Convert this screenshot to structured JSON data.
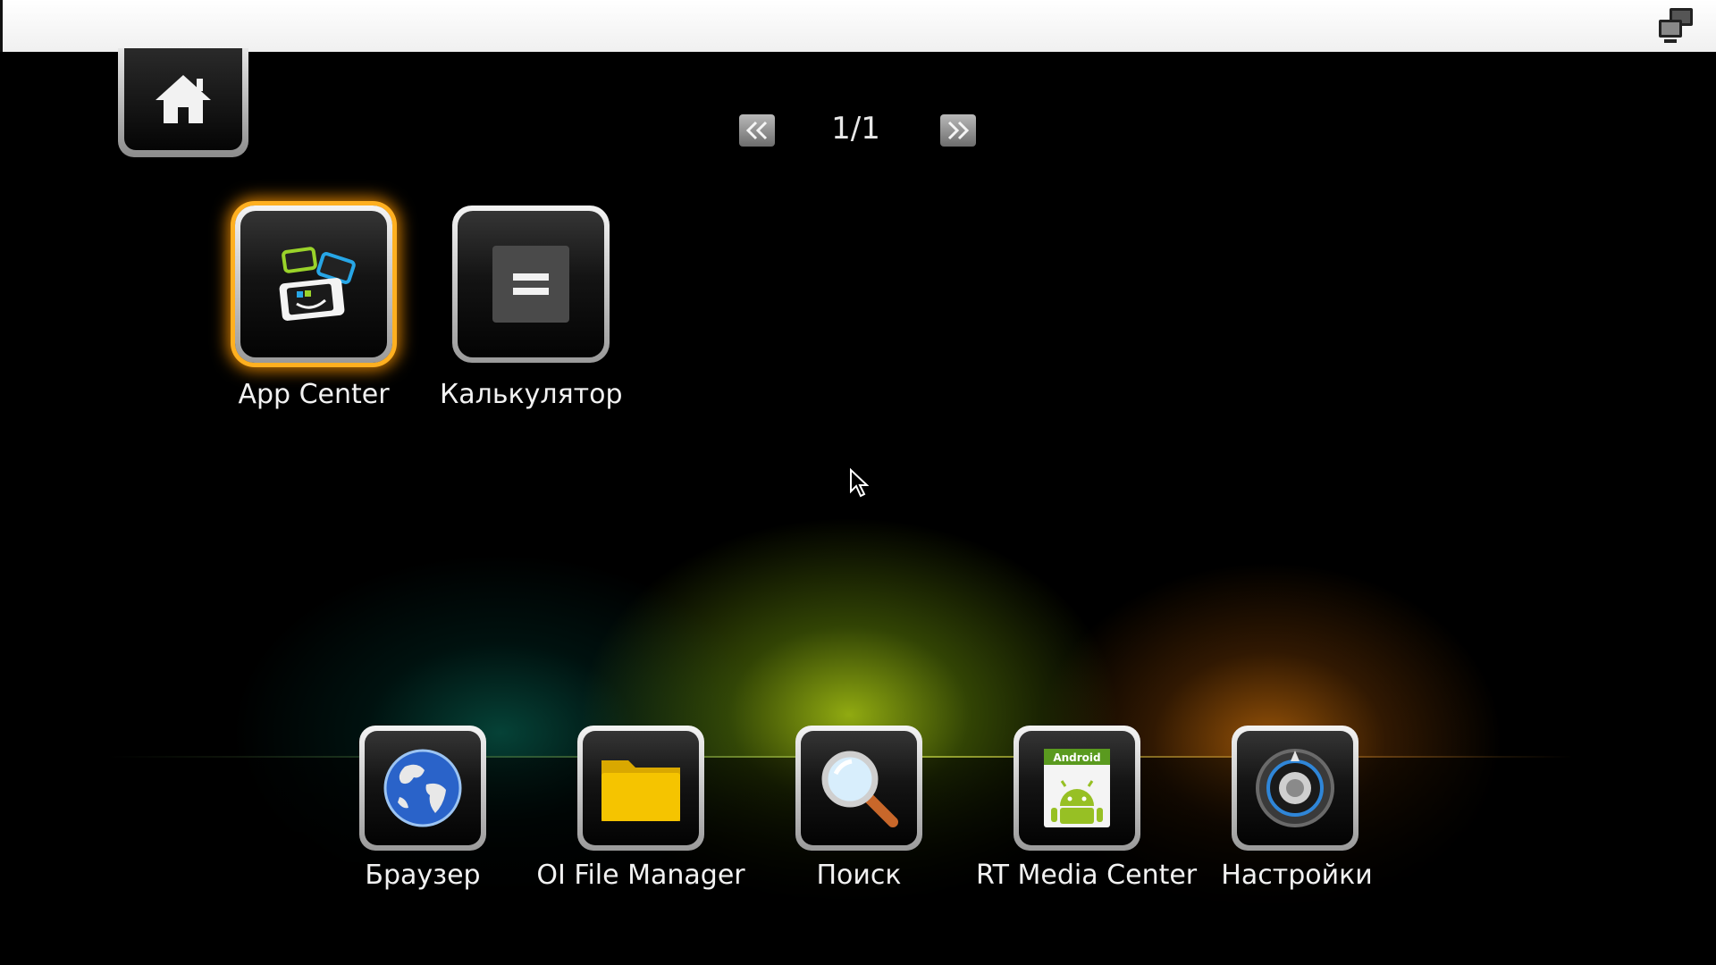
{
  "pager": {
    "prev_icon": "double-chevron-left-icon",
    "next_icon": "double-chevron-right-icon",
    "page_text": "1/1"
  },
  "top_bar": {
    "icon": "network-monitors-icon"
  },
  "home": {
    "icon": "home-icon"
  },
  "apps": [
    {
      "label": "App Center",
      "icon": "app-center-icon",
      "focused": true
    },
    {
      "label": "Калькулятор",
      "icon": "calculator-icon",
      "focused": false
    }
  ],
  "dock": [
    {
      "label": "Браузер",
      "icon": "globe-icon"
    },
    {
      "label": "OI File Manager",
      "icon": "folder-icon"
    },
    {
      "label": "Поиск",
      "icon": "magnifier-icon"
    },
    {
      "label": "RT Media Center",
      "icon": "android-media-icon",
      "badge_text": "Android"
    },
    {
      "label": "Настройки",
      "icon": "settings-dial-icon"
    }
  ],
  "colors": {
    "focus_glow": "#ffb020",
    "folder": "#f5c400",
    "android_green": "#97c024"
  }
}
